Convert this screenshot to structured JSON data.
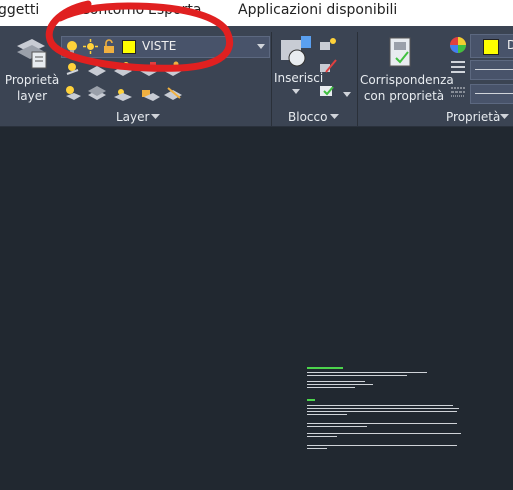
{
  "topbar": {
    "items": [
      "ggetti",
      "Contorno",
      "Esporta",
      "Applicazioni disponibili"
    ]
  },
  "ribbon": {
    "layer_panel": {
      "properties_button": [
        "Proprietà",
        "layer"
      ],
      "current_layer": "VISTE",
      "panel_label": "Layer"
    },
    "block_panel": {
      "insert_button": "Inserisci",
      "panel_label": "Blocco"
    },
    "properties_panel": {
      "match_button": [
        "Corrispondenza",
        "con proprietà"
      ],
      "panel_label": "Proprietà",
      "color_value": "D"
    }
  },
  "colors": {
    "ribbon": "#3b4453",
    "canvas": "#212830",
    "layer_color": "#ffff00",
    "annotation": "#e02020"
  },
  "icons": [
    "layer-properties-icon",
    "bulb-icon",
    "sun-icon",
    "lock-icon",
    "chevron-down-icon",
    "insert-block-icon",
    "match-properties-icon",
    "color-wheel-icon"
  ]
}
